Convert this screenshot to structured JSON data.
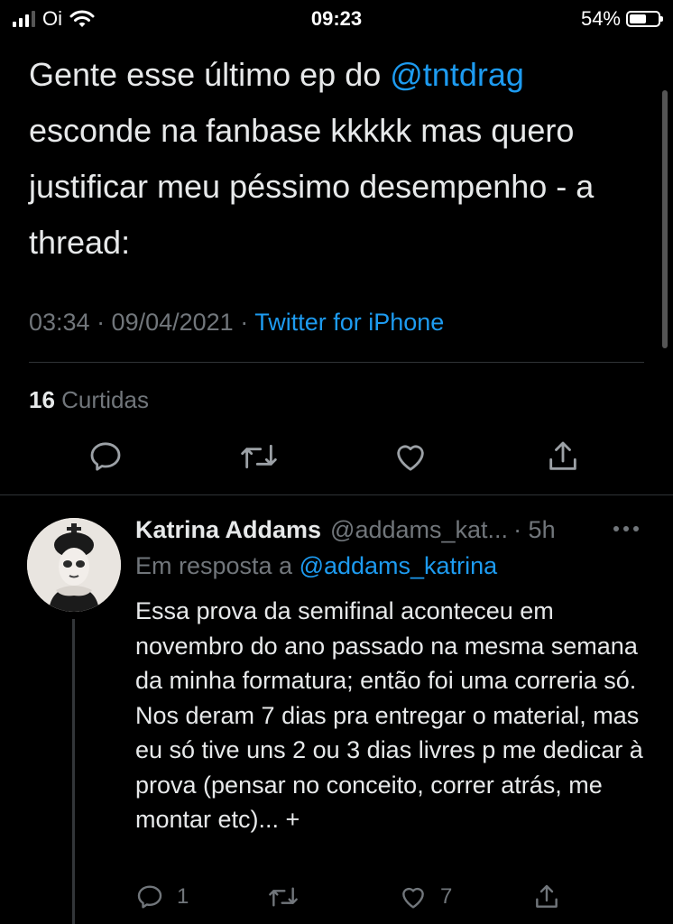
{
  "status_bar": {
    "carrier": "Oi",
    "time": "09:23",
    "battery": "54%"
  },
  "main_tweet": {
    "text_before": "Gente esse último ep do ",
    "mention": "@tntdrag",
    "text_after": " esconde na fanbase kkkkk mas quero justificar meu péssimo desempenho - a thread:",
    "timestamp": "03:34 · 09/04/2021 · ",
    "source": "Twitter for iPhone",
    "likes_count": "16",
    "likes_label": "Curtidas"
  },
  "reply": {
    "name": "Katrina Addams",
    "handle": "@addams_kat...",
    "time": "· 5h",
    "reply_to_label": "Em resposta a ",
    "reply_to_handle": "@addams_katrina",
    "text": "Essa prova da semifinal aconteceu em novembro do ano passado na mesma semana da minha formatura; então foi uma correria só. Nos deram 7 dias pra entregar o material, mas eu só tive uns 2 ou 3 dias livres p me dedicar à prova (pensar no conceito, correr atrás, me montar etc)... +",
    "reply_count": "1",
    "like_count": "7"
  },
  "icons": [
    "signal-icon",
    "wifi-icon",
    "battery-icon",
    "reply-icon",
    "retweet-icon",
    "like-icon",
    "share-icon",
    "more-icon"
  ],
  "colors": {
    "background": "#000000",
    "text": "#e7e9ea",
    "secondary": "#71767b",
    "link": "#1d9bf0"
  }
}
